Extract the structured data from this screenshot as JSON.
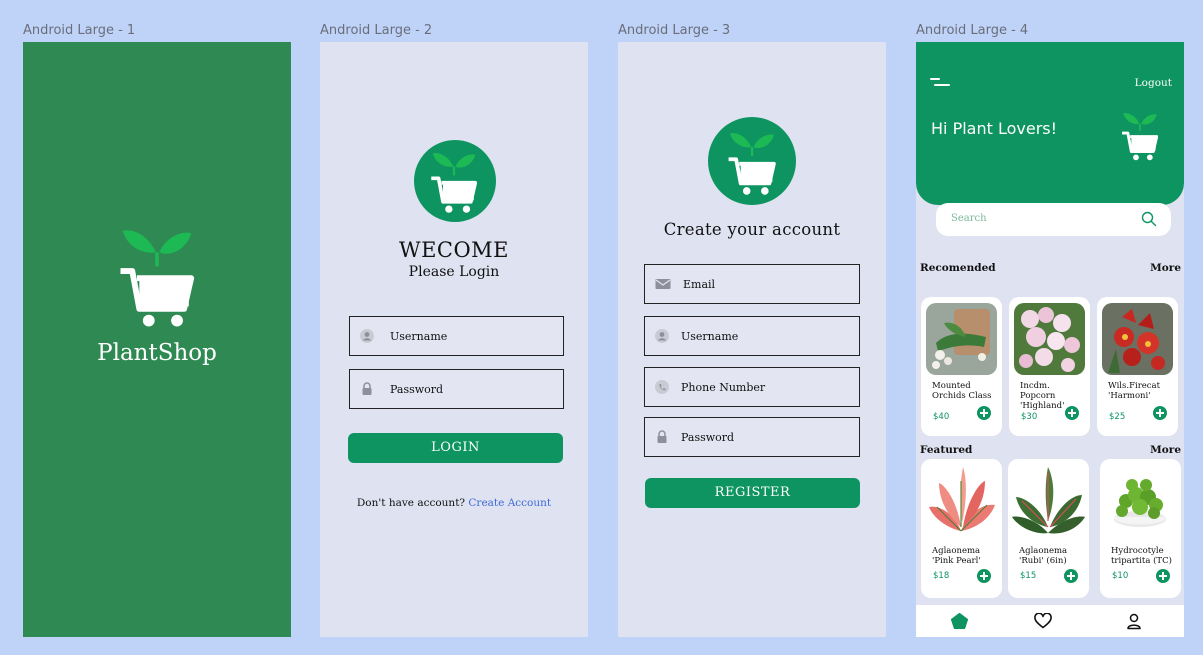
{
  "frames": [
    {
      "label": "Android Large - 1"
    },
    {
      "label": "Android Large - 2"
    },
    {
      "label": "Android Large - 3"
    },
    {
      "label": "Android Large - 4"
    }
  ],
  "splash": {
    "brand": "PlantShop"
  },
  "login": {
    "welcome": "WECOME",
    "subtitle": "Please Login",
    "username": "Username",
    "password": "Password",
    "login_button": "LOGIN",
    "no_account": "Don't have account? ",
    "create_account": "Create  Account"
  },
  "register": {
    "title": "Create your account",
    "email": "Email",
    "username": "Username",
    "phone": "Phone Number",
    "password": "Password",
    "register_button": "REGISTER"
  },
  "home": {
    "logout": "Logout",
    "greeting": "Hi Plant Lovers!",
    "search_placeholder": "Search",
    "recommended_title": "Recomended",
    "recommended_more": "More",
    "featured_title": "Featured",
    "featured_more": "More",
    "recommended": [
      {
        "name_line1": "Mounted",
        "name_line2": "Orchids Class",
        "price": "$40"
      },
      {
        "name_line1": "Incdm. Popcorn",
        "name_line2": "'Highland'",
        "price": "$30"
      },
      {
        "name_line1": "Wils.Firecat",
        "name_line2": "'Harmoni'",
        "price": "$25"
      }
    ],
    "featured": [
      {
        "name_line1": "Aglaonema",
        "name_line2": "'Pink Pearl'",
        "price": "$18"
      },
      {
        "name_line1": "Aglaonema",
        "name_line2": "'Rubi' (6in)",
        "price": "$15"
      },
      {
        "name_line1": "Hydrocotyle",
        "name_line2": "tripartita (TC)",
        "price": "$10"
      }
    ]
  },
  "colors": {
    "brand_green": "#0d9460",
    "splash_green": "#2e8a52",
    "canvas_blue": "#bfd3f8",
    "frame_bg": "#dfe2f0",
    "link_blue": "#3e6bd8"
  },
  "icons": [
    "plant-cart-logo",
    "user-icon",
    "lock-icon",
    "mail-icon",
    "phone-icon",
    "menu-icon",
    "search-icon",
    "home-icon",
    "heart-icon",
    "profile-icon",
    "plus-icon"
  ]
}
